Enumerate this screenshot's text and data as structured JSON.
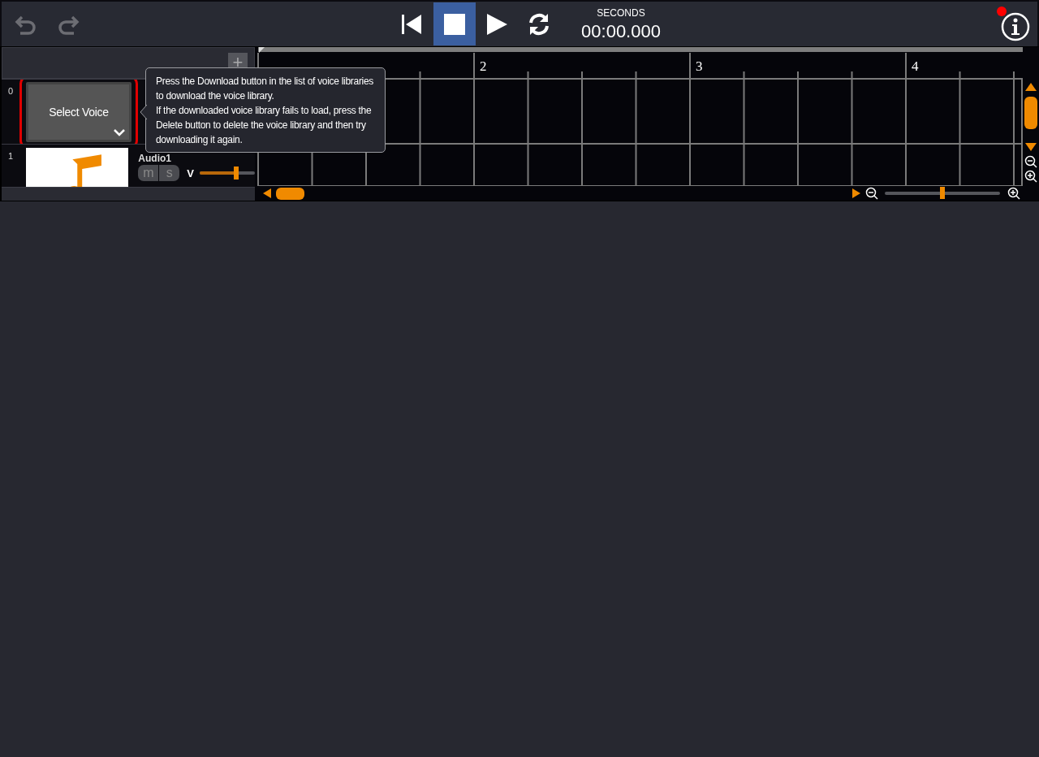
{
  "toolbar": {
    "undo": {
      "disabled": true
    },
    "redo": {
      "disabled": true
    },
    "transport": [
      {
        "kind": "skip-start",
        "selected": false
      },
      {
        "kind": "stop",
        "selected": true
      },
      {
        "kind": "play",
        "selected": false
      },
      {
        "kind": "loop",
        "selected": false
      }
    ],
    "time_unit": "SECONDS",
    "time": "00:00.000",
    "info": {
      "notification": true
    }
  },
  "tracks_header": {
    "add_button": "+"
  },
  "tracks": [
    {
      "number": "0",
      "kind": "voice",
      "voice_button": "Select Voice",
      "highlighted": true
    },
    {
      "number": "1",
      "kind": "audio",
      "name": "Audio1",
      "mute": "m",
      "solo": "s",
      "volume_label": "V",
      "level": 0.66
    }
  ],
  "timeline": {
    "bars": [
      "2",
      "3",
      "4"
    ]
  },
  "zoom": {
    "level": 0.5
  },
  "tooltip": {
    "paragraphs": [
      "Press the Download button in the list of voice libraries to download the voice library.",
      "If the downloaded voice library fails to load, press the Delete button to delete the voice library and then try downloading it again."
    ]
  }
}
